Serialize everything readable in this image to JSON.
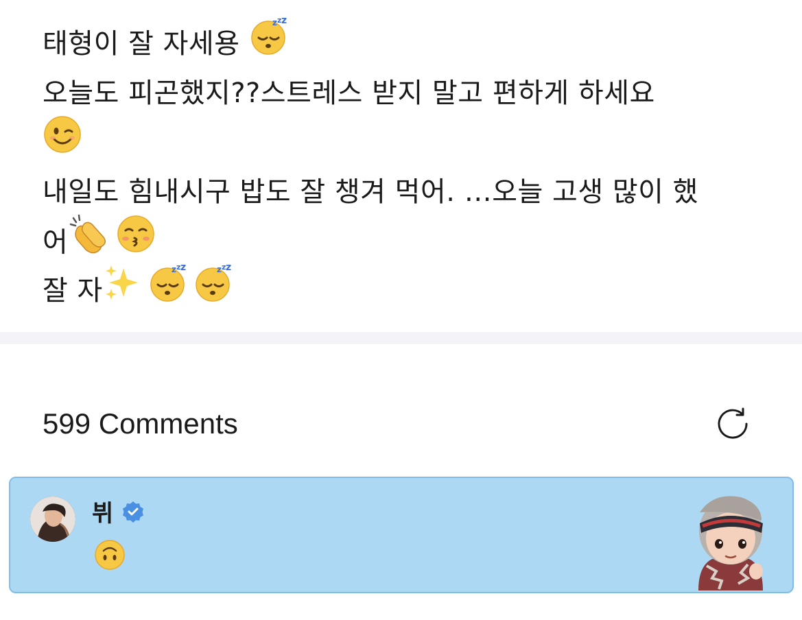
{
  "post": {
    "lines": [
      "태형이 잘 자세용",
      "오늘도 피곤했지??스트레스 받지 말고 편하게 하세요",
      "내일도 힘내시구 밥도 잘 챙겨 먹어. …오늘 고생 많이 했",
      "어",
      "잘 자"
    ],
    "emojis": {
      "line1": [
        "sleeping-face"
      ],
      "line2_wrap": [
        "winking-face"
      ],
      "line4": [
        "clapping-hands",
        "kissing-face-closed-eyes"
      ],
      "line5": [
        "sparkles",
        "sleeping-face",
        "sleeping-face"
      ]
    }
  },
  "comments": {
    "count_label": "599 Comments",
    "refresh_icon": "refresh-icon"
  },
  "highlight_comment": {
    "author": "뷔",
    "verified": true,
    "emoji": "upside-down-face",
    "background_color": "#add8f3",
    "border_color": "#7fbde6",
    "verified_color": "#4a90e2"
  }
}
